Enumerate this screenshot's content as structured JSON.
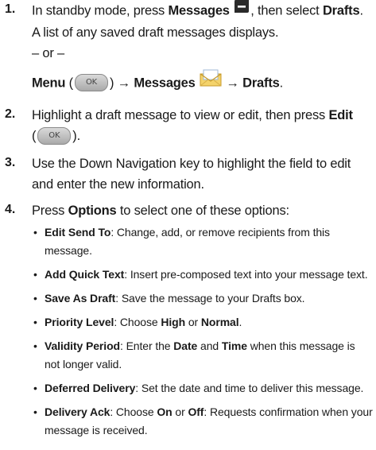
{
  "steps": [
    {
      "num": "1.",
      "line1_pre": "In standby mode, press ",
      "line1_b1": "Messages",
      "line1_mid": ", then select ",
      "line1_b2": "Drafts",
      "line1_end": ".",
      "line2": "A list of any saved draft messages displays.",
      "or": "– or –",
      "alt_b1": "Menu",
      "alt_open": " (",
      "alt_close": ") → ",
      "alt_b2": "Messages",
      "alt_arrow": " → ",
      "alt_b3": "Drafts",
      "alt_end": "."
    },
    {
      "num": "2.",
      "pre": "Highlight a draft message to view or edit, then press ",
      "b1": "Edit",
      "open": "(",
      "close": ")."
    },
    {
      "num": "3.",
      "text": "Use the Down Navigation key to highlight the field to edit and enter the new information."
    },
    {
      "num": "4.",
      "pre": "Press ",
      "b1": "Options",
      "post": " to select one of these options:"
    }
  ],
  "key_label": "OK",
  "bullets": [
    {
      "term": "Edit Send To",
      "desc": ": Change, add, or remove recipients from this message."
    },
    {
      "term": "Add Quick Text",
      "desc": ": Insert pre-composed text into your message text."
    },
    {
      "term": "Save As Draft",
      "desc": ": Save the message to your Drafts box."
    },
    {
      "term": "Priority Level",
      "desc_pre": ": Choose ",
      "b1": "High",
      "mid": " or ",
      "b2": "Normal",
      "end": "."
    },
    {
      "term": "Validity Period",
      "desc_pre": ": Enter the ",
      "b1": "Date",
      "mid": " and ",
      "b2": "Time",
      "end": " when this message is not longer valid."
    },
    {
      "term": "Deferred Delivery",
      "desc": ": Set the date and time to deliver this message."
    },
    {
      "term": "Delivery Ack",
      "desc_pre": ": Choose ",
      "b1": "On",
      "mid": " or ",
      "b2": "Off",
      "end": ": Requests confirmation when your message is received."
    }
  ],
  "icons": {
    "messages_key": "messages-key-icon",
    "envelope": "envelope-icon",
    "bullet": "•"
  }
}
